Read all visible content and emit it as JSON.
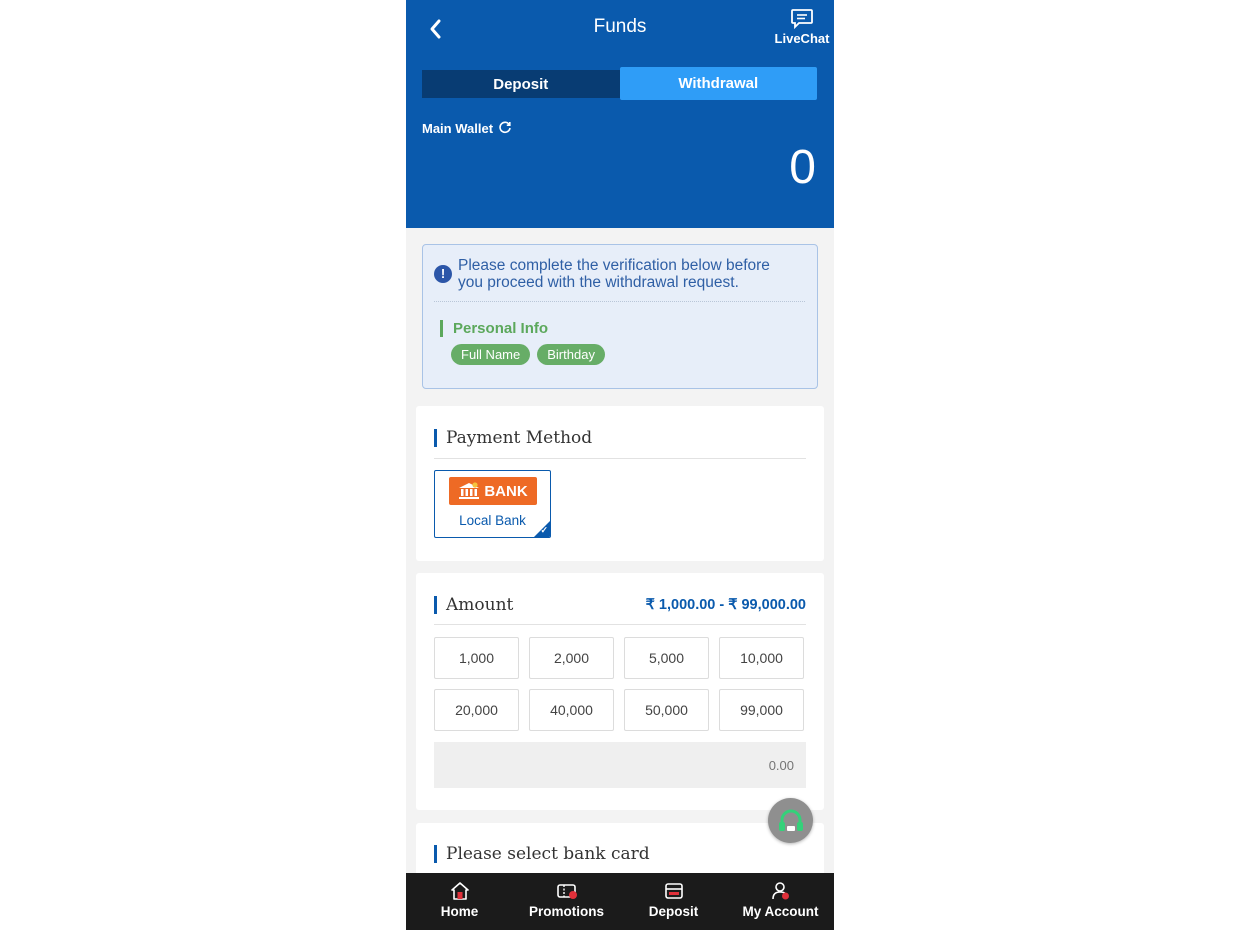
{
  "header": {
    "title": "Funds",
    "livechat_label": "LiveChat",
    "tabs": [
      {
        "label": "Deposit",
        "active": false
      },
      {
        "label": "Withdrawal",
        "active": true
      }
    ],
    "wallet_label": "Main Wallet",
    "wallet_amount": "0"
  },
  "verification": {
    "message": "Please complete the verification below before you proceed with the withdrawal request.",
    "section_label": "Personal Info",
    "chips": [
      "Full Name",
      "Birthday"
    ]
  },
  "payment": {
    "title": "Payment Method",
    "option_logo_text": "BANK",
    "option_label": "Local Bank"
  },
  "amount": {
    "title": "Amount",
    "range": "₹ 1,000.00 - ₹ 99,000.00",
    "presets": [
      "1,000",
      "2,000",
      "5,000",
      "10,000",
      "20,000",
      "40,000",
      "50,000",
      "99,000"
    ],
    "input_placeholder": "0.00"
  },
  "bank_card": {
    "title": "Please select bank card"
  },
  "bottom_nav": [
    {
      "label": "Home",
      "icon": "home-icon"
    },
    {
      "label": "Promotions",
      "icon": "promotions-icon"
    },
    {
      "label": "Deposit",
      "icon": "deposit-icon"
    },
    {
      "label": "My Account",
      "icon": "account-icon"
    }
  ],
  "colors": {
    "primary": "#0a5aad",
    "tab_active": "#2f9df7",
    "tab_inactive": "#083c73",
    "verified_green": "#67ad67",
    "bank_orange": "#ee6a25",
    "nav_background": "#1b1b1b"
  }
}
